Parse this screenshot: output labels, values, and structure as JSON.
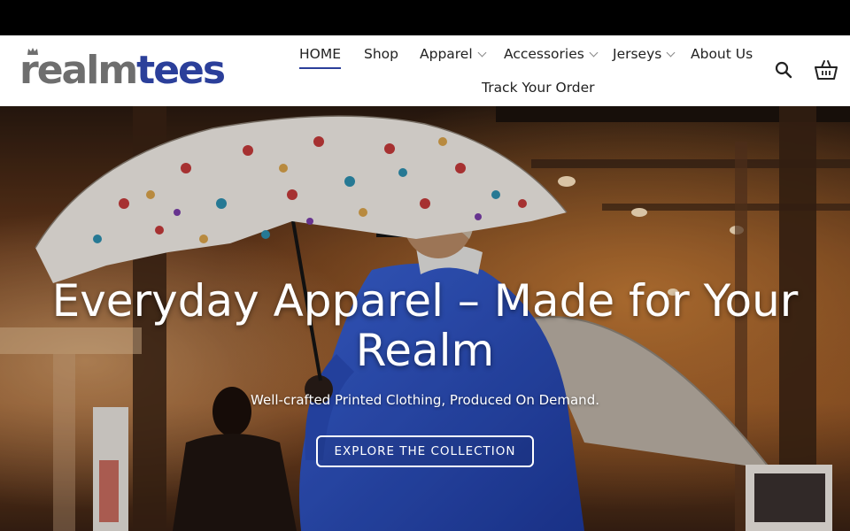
{
  "header": {
    "logo": {
      "part1": "realm",
      "part2": "tees"
    },
    "nav": [
      {
        "label": "HOME",
        "dropdown": false,
        "active": true
      },
      {
        "label": "Shop",
        "dropdown": false,
        "active": false
      },
      {
        "label": "Apparel",
        "dropdown": true,
        "active": false
      },
      {
        "label": "Accessories",
        "dropdown": true,
        "active": false
      },
      {
        "label": "Jerseys",
        "dropdown": true,
        "active": false
      },
      {
        "label": "About Us",
        "dropdown": false,
        "active": false
      },
      {
        "label": "Track Your Order",
        "dropdown": false,
        "active": false
      }
    ],
    "icons": [
      "search-icon",
      "cart-icon"
    ]
  },
  "hero": {
    "title_line1": "Everyday Apparel – Made for Your",
    "title_line2": "Realm",
    "subtitle": "Well-crafted Printed Clothing, Produced On Demand.",
    "button_label": "EXPLORE THE COLLECTION"
  },
  "colors": {
    "accent": "#2b3f9a",
    "logo_gray": "#6e6e6e",
    "top_bar": "#000000",
    "jacket_blue": "#2c4fbf"
  }
}
